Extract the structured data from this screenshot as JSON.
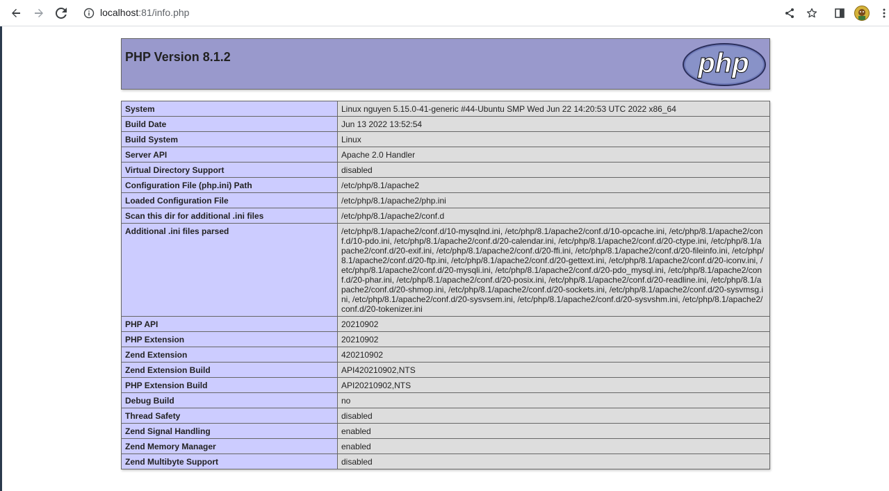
{
  "browser": {
    "url_host": "localhost",
    "url_rest": ":81/info.php",
    "icons": [
      "back-arrow-icon",
      "forward-arrow-icon",
      "reload-icon",
      "info-icon",
      "share-icon",
      "star-icon",
      "side-panel-icon",
      "avatar",
      "kebab-menu-icon"
    ]
  },
  "header": {
    "title": "PHP Version 8.1.2",
    "logo_text": "php",
    "colors": {
      "header_bg": "#9999cc",
      "label_bg": "#ccccff",
      "value_bg": "#dddddd"
    }
  },
  "rows": [
    {
      "label": "System",
      "value": "Linux nguyen 5.15.0-41-generic #44-Ubuntu SMP Wed Jun 22 14:20:53 UTC 2022 x86_64"
    },
    {
      "label": "Build Date",
      "value": "Jun 13 2022 13:52:54"
    },
    {
      "label": "Build System",
      "value": "Linux"
    },
    {
      "label": "Server API",
      "value": "Apache 2.0 Handler"
    },
    {
      "label": "Virtual Directory Support",
      "value": "disabled"
    },
    {
      "label": "Configuration File (php.ini) Path",
      "value": "/etc/php/8.1/apache2"
    },
    {
      "label": "Loaded Configuration File",
      "value": "/etc/php/8.1/apache2/php.ini"
    },
    {
      "label": "Scan this dir for additional .ini files",
      "value": "/etc/php/8.1/apache2/conf.d"
    },
    {
      "label": "Additional .ini files parsed",
      "value": "/etc/php/8.1/apache2/conf.d/10-mysqlnd.ini, /etc/php/8.1/apache2/conf.d/10-opcache.ini, /etc/php/8.1/apache2/conf.d/10-pdo.ini, /etc/php/8.1/apache2/conf.d/20-calendar.ini, /etc/php/8.1/apache2/conf.d/20-ctype.ini, /etc/php/8.1/apache2/conf.d/20-exif.ini, /etc/php/8.1/apache2/conf.d/20-ffi.ini, /etc/php/8.1/apache2/conf.d/20-fileinfo.ini, /etc/php/8.1/apache2/conf.d/20-ftp.ini, /etc/php/8.1/apache2/conf.d/20-gettext.ini, /etc/php/8.1/apache2/conf.d/20-iconv.ini, /etc/php/8.1/apache2/conf.d/20-mysqli.ini, /etc/php/8.1/apache2/conf.d/20-pdo_mysql.ini, /etc/php/8.1/apache2/conf.d/20-phar.ini, /etc/php/8.1/apache2/conf.d/20-posix.ini, /etc/php/8.1/apache2/conf.d/20-readline.ini, /etc/php/8.1/apache2/conf.d/20-shmop.ini, /etc/php/8.1/apache2/conf.d/20-sockets.ini, /etc/php/8.1/apache2/conf.d/20-sysvmsg.ini, /etc/php/8.1/apache2/conf.d/20-sysvsem.ini, /etc/php/8.1/apache2/conf.d/20-sysvshm.ini, /etc/php/8.1/apache2/conf.d/20-tokenizer.ini"
    },
    {
      "label": "PHP API",
      "value": "20210902"
    },
    {
      "label": "PHP Extension",
      "value": "20210902"
    },
    {
      "label": "Zend Extension",
      "value": "420210902"
    },
    {
      "label": "Zend Extension Build",
      "value": "API420210902,NTS"
    },
    {
      "label": "PHP Extension Build",
      "value": "API20210902,NTS"
    },
    {
      "label": "Debug Build",
      "value": "no"
    },
    {
      "label": "Thread Safety",
      "value": "disabled"
    },
    {
      "label": "Zend Signal Handling",
      "value": "enabled"
    },
    {
      "label": "Zend Memory Manager",
      "value": "enabled"
    },
    {
      "label": "Zend Multibyte Support",
      "value": "disabled"
    }
  ]
}
